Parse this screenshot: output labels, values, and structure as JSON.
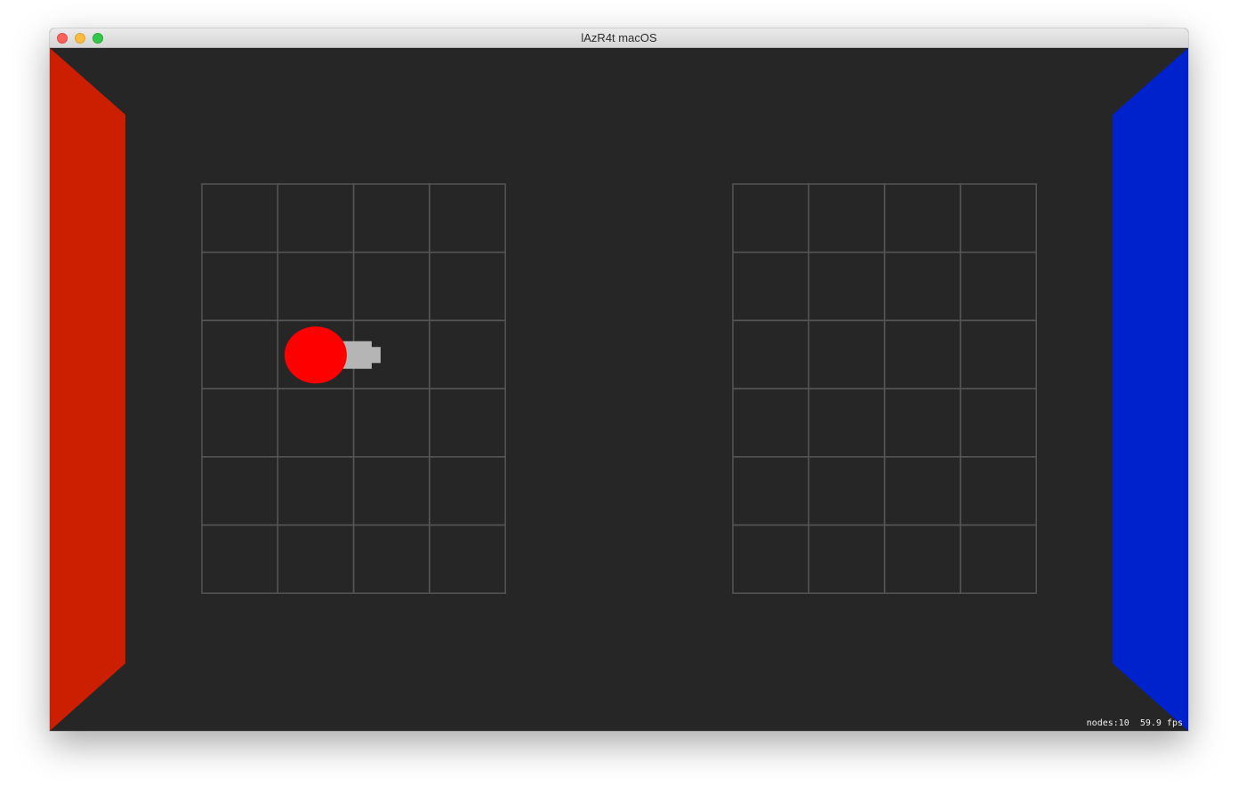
{
  "window": {
    "title": "lAzR4t macOS"
  },
  "scene": {
    "background_color": "#262626",
    "left_wall_color": "#cc1e00",
    "right_wall_color": "#0022cc",
    "grid_line_color": "#555555",
    "left_grid": {
      "columns": 4,
      "rows": 6
    },
    "right_grid": {
      "columns": 4,
      "rows": 6
    },
    "player": {
      "body_color": "#ff0000",
      "cannon_color": "#b5b5b5",
      "cell": {
        "column": 2,
        "row": 3
      }
    }
  },
  "stats": {
    "nodes": "nodes:10",
    "fps": "59.9 fps"
  }
}
